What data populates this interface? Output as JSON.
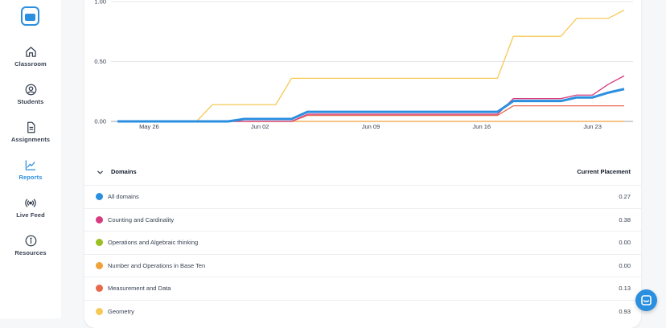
{
  "nav": {
    "items": [
      {
        "label": "Classroom",
        "icon": "home-icon"
      },
      {
        "label": "Students",
        "icon": "user-circle-icon"
      },
      {
        "label": "Assignments",
        "icon": "document-icon"
      },
      {
        "label": "Reports",
        "icon": "trend-chart-icon",
        "active": true
      },
      {
        "label": "Live Feed",
        "icon": "broadcast-icon"
      },
      {
        "label": "Resources",
        "icon": "info-icon"
      }
    ]
  },
  "colors": {
    "accent": "#2b8fe0",
    "all_domains": "#2b8fe0",
    "counting": "#d63c7f",
    "operations_algebraic": "#9bbf1f",
    "number_base_ten": "#f0a13a",
    "measurement": "#e8684a",
    "geometry": "#f6c955"
  },
  "chart_data": {
    "type": "line",
    "x": [
      "May 24",
      "May 25",
      "May 26",
      "May 27",
      "May 28",
      "May 29",
      "May 30",
      "May 31",
      "Jun 01",
      "Jun 02",
      "Jun 03",
      "Jun 04",
      "Jun 05",
      "Jun 06",
      "Jun 07",
      "Jun 08",
      "Jun 09",
      "Jun 10",
      "Jun 11",
      "Jun 12",
      "Jun 13",
      "Jun 14",
      "Jun 15",
      "Jun 16",
      "Jun 17",
      "Jun 18",
      "Jun 19",
      "Jun 20",
      "Jun 21",
      "Jun 22",
      "Jun 23",
      "Jun 24",
      "Jun 25"
    ],
    "xticks": [
      "May 26",
      "Jun 02",
      "Jun 09",
      "Jun 16",
      "Jun 23"
    ],
    "yticks": [
      "0.00",
      "0.50",
      "1.00"
    ],
    "ylim": [
      0,
      1
    ],
    "grid": true,
    "series": [
      {
        "name": "All domains",
        "color": "#2b8fe0",
        "bold": true,
        "values": [
          0,
          0,
          0,
          0,
          0,
          0,
          0,
          0,
          0.02,
          0.02,
          0.02,
          0.02,
          0.08,
          0.08,
          0.08,
          0.08,
          0.08,
          0.08,
          0.08,
          0.08,
          0.08,
          0.08,
          0.08,
          0.08,
          0.08,
          0.17,
          0.17,
          0.17,
          0.17,
          0.2,
          0.2,
          0.24,
          0.27
        ]
      },
      {
        "name": "Counting and Cardinality",
        "color": "#d63c7f",
        "values": [
          0,
          0,
          0,
          0,
          0,
          0,
          0,
          0,
          0,
          0,
          0,
          0,
          0.06,
          0.06,
          0.06,
          0.06,
          0.06,
          0.06,
          0.06,
          0.06,
          0.06,
          0.06,
          0.06,
          0.06,
          0.06,
          0.19,
          0.19,
          0.19,
          0.19,
          0.22,
          0.22,
          0.31,
          0.38
        ]
      },
      {
        "name": "Measurement and Data",
        "color": "#e8684a",
        "values": [
          0,
          0,
          0,
          0,
          0,
          0,
          0,
          0,
          0,
          0,
          0,
          0,
          0.05,
          0.05,
          0.05,
          0.05,
          0.05,
          0.05,
          0.05,
          0.05,
          0.05,
          0.05,
          0.05,
          0.05,
          0.05,
          0.13,
          0.13,
          0.13,
          0.13,
          0.13,
          0.13,
          0.13,
          0.13
        ]
      },
      {
        "name": "Number and Operations in Base Ten",
        "color": "#f0a13a",
        "values": [
          0,
          0,
          0,
          0,
          0,
          0,
          0,
          0,
          0,
          0,
          0,
          0,
          0,
          0,
          0,
          0,
          0,
          0,
          0,
          0,
          0,
          0,
          0,
          0,
          0,
          0,
          0,
          0,
          0,
          0,
          0,
          0,
          0
        ]
      },
      {
        "name": "Geometry",
        "color": "#f6c955",
        "values": [
          0,
          0,
          0,
          0,
          0,
          0,
          0.14,
          0.14,
          0.14,
          0.14,
          0.14,
          0.36,
          0.36,
          0.36,
          0.36,
          0.36,
          0.36,
          0.36,
          0.36,
          0.36,
          0.36,
          0.36,
          0.36,
          0.36,
          0.36,
          0.71,
          0.71,
          0.71,
          0.71,
          0.86,
          0.86,
          0.86,
          0.93
        ]
      }
    ]
  },
  "table": {
    "header_domains": "Domains",
    "header_placement": "Current Placement",
    "rows": [
      {
        "name": "All domains",
        "value": "0.27",
        "color": "#2b8fe0"
      },
      {
        "name": "Counting and Cardinality",
        "value": "0.38",
        "color": "#d63c7f"
      },
      {
        "name": "Operations and Algebraic thinking",
        "value": "0.00",
        "color": "#9bbf1f"
      },
      {
        "name": "Number and Operations in Base Ten",
        "value": "0.00",
        "color": "#f0a13a"
      },
      {
        "name": "Measurement and Data",
        "value": "0.13",
        "color": "#e8684a"
      },
      {
        "name": "Geometry",
        "value": "0.93",
        "color": "#f6c955"
      }
    ]
  }
}
